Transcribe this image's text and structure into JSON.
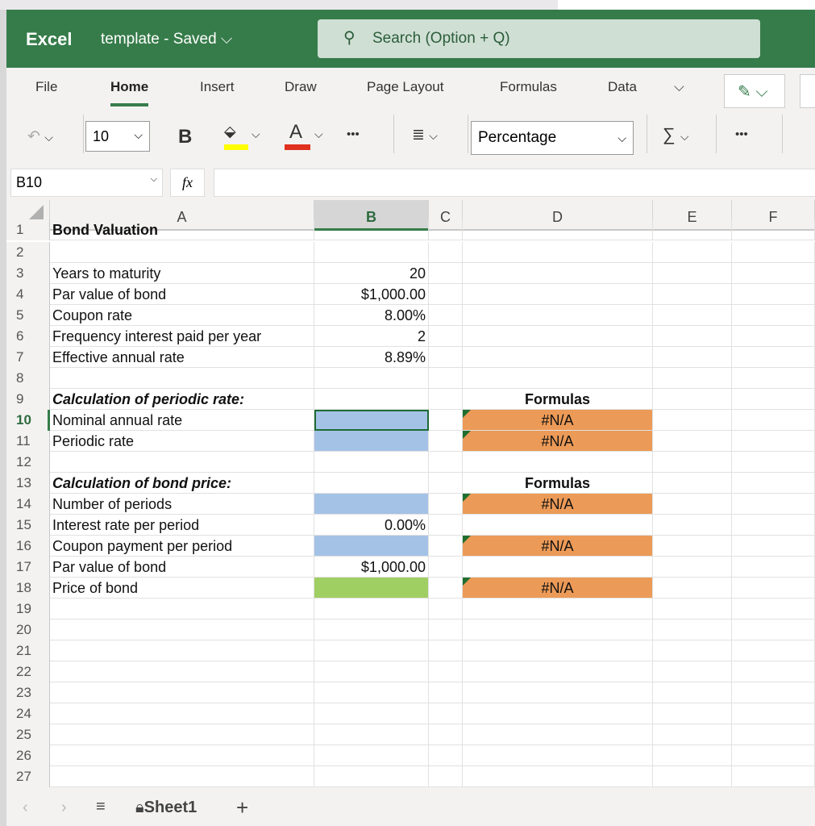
{
  "app": {
    "name": "Excel",
    "doc_title": "template",
    "status": "Saved",
    "search_placeholder": "Search (Option + Q)"
  },
  "tabs": [
    {
      "label": "File"
    },
    {
      "label": "Home",
      "active": true
    },
    {
      "label": "Insert"
    },
    {
      "label": "Draw"
    },
    {
      "label": "Page Layout"
    },
    {
      "label": "Formulas"
    },
    {
      "label": "Data"
    }
  ],
  "toolbar": {
    "font_size": "10",
    "bold": "B",
    "font_color_glyph": "A",
    "more": "•••",
    "number_format": "Percentage",
    "sum": "∑",
    "highlight_color": "#ffff00",
    "font_color": "#e0301e"
  },
  "formula_bar": {
    "name_box": "B10",
    "fx": "fx",
    "value": ""
  },
  "columns": [
    "A",
    "B",
    "C",
    "D",
    "E",
    "F"
  ],
  "selected_cell": "B10",
  "rows": [
    {
      "n": "1",
      "A": "Bond Valuation",
      "bold": true
    },
    {
      "n": "2"
    },
    {
      "n": "3",
      "A": "Years to maturity",
      "B": "20"
    },
    {
      "n": "4",
      "A": "Par value of bond",
      "B": "$1,000.00"
    },
    {
      "n": "5",
      "A": "Coupon rate",
      "B": "8.00%"
    },
    {
      "n": "6",
      "A": "Frequency interest paid per year",
      "B": "2"
    },
    {
      "n": "7",
      "A": "Effective annual rate",
      "B": "8.89%"
    },
    {
      "n": "8"
    },
    {
      "n": "9",
      "A": "Calculation of periodic rate:",
      "bi": true,
      "D": "Formulas",
      "Dbold": true
    },
    {
      "n": "10",
      "A": "Nominal annual rate",
      "Bfill": "blue",
      "D": "#N/A",
      "Dfill": "orange"
    },
    {
      "n": "11",
      "A": "Periodic rate",
      "Bfill": "blue",
      "D": "#N/A",
      "Dfill": "orange"
    },
    {
      "n": "12"
    },
    {
      "n": "13",
      "A": "Calculation of bond price:",
      "bi": true,
      "D": "Formulas",
      "Dbold": true
    },
    {
      "n": "14",
      "A": "Number of periods",
      "Bfill": "blue",
      "D": "#N/A",
      "Dfill": "orange"
    },
    {
      "n": "15",
      "A": "Interest rate per period",
      "B": "0.00%"
    },
    {
      "n": "16",
      "A": "Coupon payment per period",
      "Bfill": "blue",
      "D": "#N/A",
      "Dfill": "orange"
    },
    {
      "n": "17",
      "A": "Par value of bond",
      "B": "$1,000.00"
    },
    {
      "n": "18",
      "A": "Price of bond",
      "Bfill": "green",
      "D": "#N/A",
      "Dfill": "orange"
    },
    {
      "n": "19"
    },
    {
      "n": "20"
    },
    {
      "n": "21"
    },
    {
      "n": "22"
    },
    {
      "n": "23"
    },
    {
      "n": "24"
    },
    {
      "n": "25"
    },
    {
      "n": "26"
    },
    {
      "n": "27"
    }
  ],
  "sheets": [
    {
      "label": "Sheet1",
      "locked": true
    }
  ]
}
